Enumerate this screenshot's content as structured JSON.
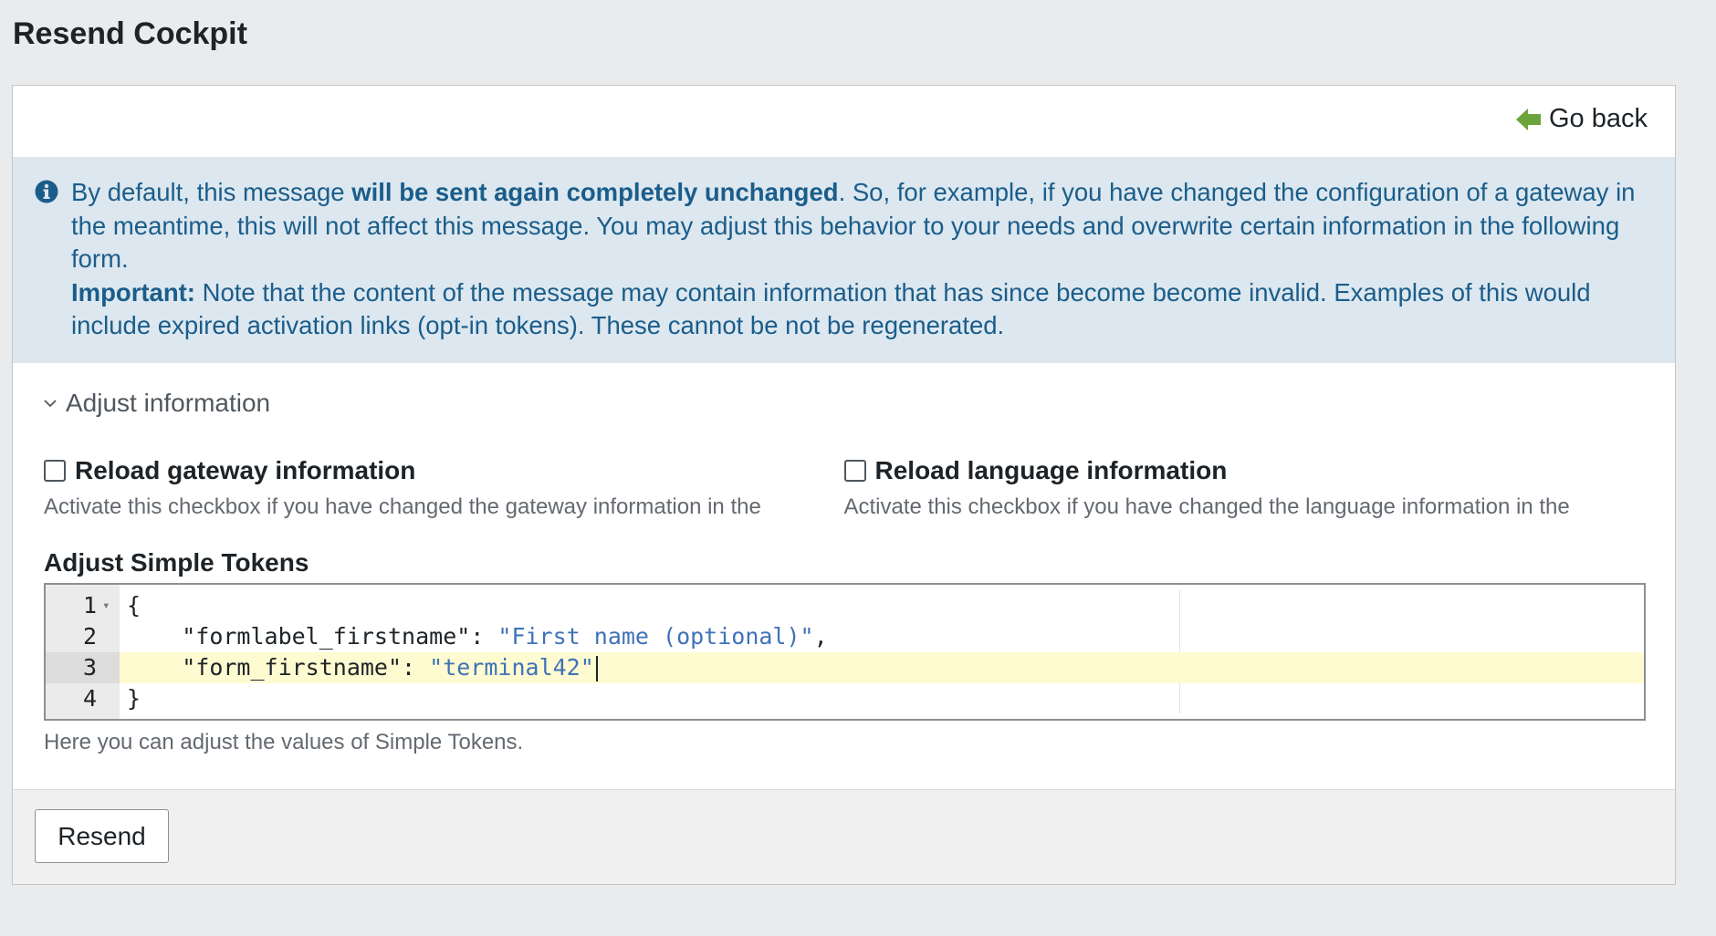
{
  "page": {
    "title": "Resend Cockpit"
  },
  "header": {
    "go_back_label": "Go back",
    "go_back_icon": "arrow-left-icon",
    "go_back_icon_color": "#6ca43c"
  },
  "notice": {
    "icon": "info-icon",
    "part1": "By default, this message ",
    "bold1": "will be sent again completely unchanged",
    "part2": ". So, for example, if you have changed the configuration of a gateway in the meantime, this will not affect this message. You may adjust this behavior to your needs and overwrite certain information in the following form.",
    "important_label": "Important:",
    "important_text": " Note that the content of the message may contain information that has since become become invalid. Examples of this would include expired activation links (opt-in tokens). These cannot be not be regenerated.",
    "text_color": "#1b5d8a",
    "background_color": "#dce7ef"
  },
  "adjust": {
    "toggle_label": "Adjust information",
    "toggle_icon": "chevron-down-icon",
    "options": [
      {
        "label": "Reload gateway information",
        "description": "Activate this checkbox if you have changed the gateway information in the",
        "checked": false
      },
      {
        "label": "Reload language information",
        "description": "Activate this checkbox if you have changed the language information in the",
        "checked": false
      }
    ]
  },
  "tokens": {
    "label": "Adjust Simple Tokens",
    "lines": [
      {
        "number": "1",
        "text": "{"
      },
      {
        "number": "2",
        "key": "\"formlabel_firstname\"",
        "value": "\"First name (optional)\"",
        "trail": ","
      },
      {
        "number": "3",
        "key": "\"form_firstname\"",
        "value": "\"terminal42\"",
        "trail": ""
      },
      {
        "number": "4",
        "text": "}"
      }
    ],
    "active_line": 3,
    "help": "Here you can adjust the values of Simple Tokens."
  },
  "footer": {
    "resend_label": "Resend"
  }
}
